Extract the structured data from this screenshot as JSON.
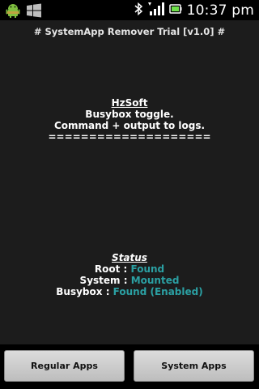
{
  "status_bar": {
    "time": "10:37 pm",
    "icons_left": [
      "android-debug-icon",
      "windows-icon"
    ],
    "icons_right": [
      "bluetooth-icon",
      "signal-icon",
      "battery-icon"
    ]
  },
  "header": {
    "title": "# SystemApp Remover Trial [v1.0] #"
  },
  "info": {
    "title": "HzSoft",
    "line1": "Busybox toggle.",
    "line2": "Command + output to logs.",
    "separator": "===================="
  },
  "status": {
    "title": "Status",
    "rows": [
      {
        "label": "Root",
        "value": "Found"
      },
      {
        "label": "System",
        "value": "Mounted"
      },
      {
        "label": "Busybox",
        "value": "Found (Enabled)"
      }
    ]
  },
  "buttons": {
    "regular": "Regular Apps",
    "system": "System Apps"
  },
  "colors": {
    "background": "#1c1c1c",
    "status_value": "#2ba0a3",
    "button": "#cfcfcf"
  }
}
